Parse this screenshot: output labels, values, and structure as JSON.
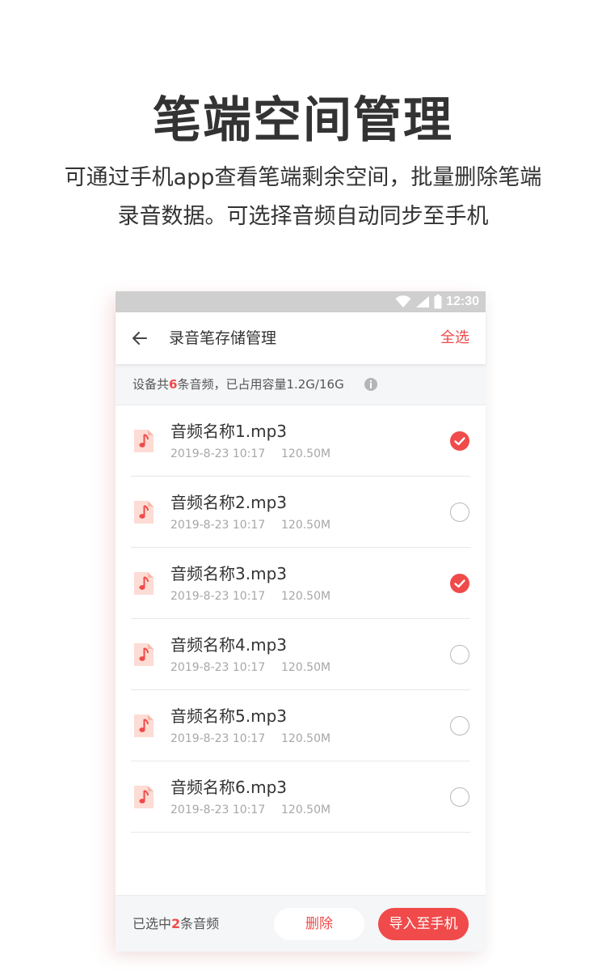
{
  "hero": {
    "title": "笔端空间管理",
    "description_line1": "可通过手机app查看笔端剩余空间，批量删除笔端",
    "description_line2": "录音数据。可选择音频自动同步至手机"
  },
  "status_bar": {
    "time": "12:30"
  },
  "app_bar": {
    "title": "录音笔存储管理",
    "select_all": "全选"
  },
  "summary": {
    "prefix": "设备共",
    "count": "6",
    "suffix": "条音频，已占用容量1.2G/16G"
  },
  "files": [
    {
      "name": "音频名称1.mp3",
      "date": "2019-8-23 10:17",
      "size": "120.50M",
      "checked": true
    },
    {
      "name": "音频名称2.mp3",
      "date": "2019-8-23 10:17",
      "size": "120.50M",
      "checked": false
    },
    {
      "name": "音频名称3.mp3",
      "date": "2019-8-23 10:17",
      "size": "120.50M",
      "checked": true
    },
    {
      "name": "音频名称4.mp3",
      "date": "2019-8-23 10:17",
      "size": "120.50M",
      "checked": false
    },
    {
      "name": "音频名称5.mp3",
      "date": "2019-8-23 10:17",
      "size": "120.50M",
      "checked": false
    },
    {
      "name": "音频名称6.mp3",
      "date": "2019-8-23 10:17",
      "size": "120.50M",
      "checked": false
    }
  ],
  "bottom_bar": {
    "prefix": "已选中",
    "count": "2",
    "suffix": "条音频",
    "delete_label": "删除",
    "import_label": "导入至手机"
  },
  "colors": {
    "accent": "#f04a4a",
    "status_bar": "#cfcfcf",
    "icon_bg": "#fcdcd4"
  },
  "icons": [
    "wifi-icon",
    "signal-icon",
    "battery-icon",
    "back-arrow-icon",
    "info-icon",
    "audio-file-icon",
    "check-icon"
  ]
}
